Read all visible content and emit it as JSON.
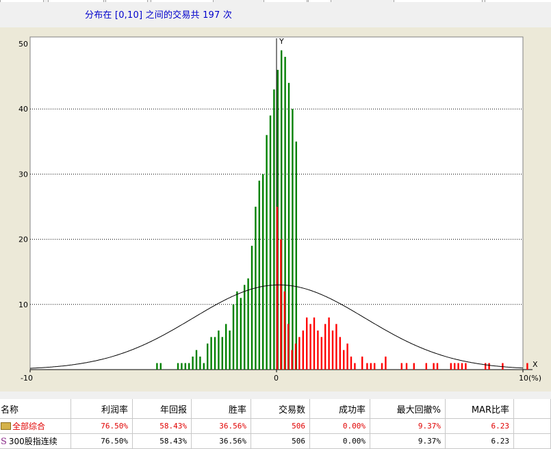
{
  "summary": {
    "text": "分布在 [0,10] 之间的交易共 197 次"
  },
  "chart_data": {
    "type": "bar",
    "x_axis_label": "X",
    "y_axis_label": "Y",
    "x_ticks": [
      "-10",
      "0",
      "10(%)"
    ],
    "y_ticks": [
      "10",
      "20",
      "30",
      "40",
      "50"
    ],
    "xlim": [
      -10,
      10
    ],
    "ylim": [
      0,
      50
    ],
    "grid": "horizontal dotted",
    "colors": {
      "loss": "#008000",
      "gain": "#ff0000",
      "curve": "#000000"
    },
    "loss_bars": [
      [
        -4.55,
        1
      ],
      [
        -4.4,
        1
      ],
      [
        -3.7,
        1
      ],
      [
        -3.55,
        1
      ],
      [
        -3.4,
        1
      ],
      [
        -3.25,
        1
      ],
      [
        -3.1,
        2
      ],
      [
        -2.95,
        3
      ],
      [
        -2.8,
        2
      ],
      [
        -2.65,
        1
      ],
      [
        -2.5,
        4
      ],
      [
        -2.35,
        5
      ],
      [
        -2.2,
        5
      ],
      [
        -2.05,
        6
      ],
      [
        -1.9,
        5
      ],
      [
        -1.75,
        7
      ],
      [
        -1.6,
        6
      ],
      [
        -1.45,
        10
      ],
      [
        -1.3,
        12
      ],
      [
        -1.15,
        11
      ],
      [
        -1.0,
        13
      ],
      [
        -0.85,
        14
      ],
      [
        -0.7,
        19
      ],
      [
        -0.55,
        25
      ],
      [
        -0.4,
        29
      ],
      [
        -0.25,
        30
      ],
      [
        -0.1,
        36
      ],
      [
        0.05,
        39
      ],
      [
        0.2,
        43
      ],
      [
        0.35,
        46
      ],
      [
        0.5,
        49
      ],
      [
        0.65,
        48
      ],
      [
        0.8,
        44
      ],
      [
        0.95,
        40
      ],
      [
        1.1,
        35
      ]
    ],
    "gain_bars": [
      [
        0.05,
        25
      ],
      [
        0.2,
        20
      ],
      [
        0.35,
        12
      ],
      [
        0.5,
        7
      ],
      [
        0.65,
        3
      ],
      [
        0.8,
        4
      ],
      [
        0.95,
        5
      ],
      [
        1.1,
        6
      ],
      [
        1.25,
        8
      ],
      [
        1.4,
        7
      ],
      [
        1.55,
        8
      ],
      [
        1.7,
        6
      ],
      [
        1.85,
        5
      ],
      [
        2.0,
        7
      ],
      [
        2.15,
        8
      ],
      [
        2.3,
        6
      ],
      [
        2.45,
        7
      ],
      [
        2.6,
        5
      ],
      [
        2.75,
        3
      ],
      [
        2.9,
        4
      ],
      [
        3.05,
        2
      ],
      [
        3.2,
        1
      ],
      [
        3.5,
        2
      ],
      [
        3.7,
        1
      ],
      [
        3.85,
        1
      ],
      [
        4.0,
        1
      ],
      [
        4.3,
        1
      ],
      [
        4.45,
        2
      ],
      [
        5.1,
        1
      ],
      [
        5.3,
        1
      ],
      [
        5.6,
        1
      ],
      [
        6.1,
        1
      ],
      [
        6.4,
        1
      ],
      [
        6.55,
        1
      ],
      [
        7.1,
        1
      ],
      [
        7.25,
        1
      ],
      [
        7.4,
        1
      ],
      [
        7.55,
        1
      ],
      [
        7.7,
        1
      ],
      [
        8.5,
        1
      ],
      [
        8.65,
        1
      ],
      [
        9.2,
        1
      ],
      [
        10.2,
        1
      ]
    ],
    "normal_curve": {
      "mean": 0.1,
      "sigma": 3.5,
      "peak": 13
    }
  },
  "table": {
    "headers": [
      "名称",
      "利润率",
      "年回报",
      "胜率",
      "交易数",
      "成功率",
      "最大回撤%",
      "MAR比率"
    ],
    "rows": [
      {
        "name": "全部综合",
        "values": [
          "76.50%",
          "58.43%",
          "36.56%",
          "506",
          "0.00%",
          "9.37%",
          "6.23"
        ]
      },
      {
        "name": "300股指连续",
        "values": [
          "76.50%",
          "58.43%",
          "36.56%",
          "506",
          "0.00%",
          "9.37%",
          "6.23"
        ]
      }
    ]
  }
}
